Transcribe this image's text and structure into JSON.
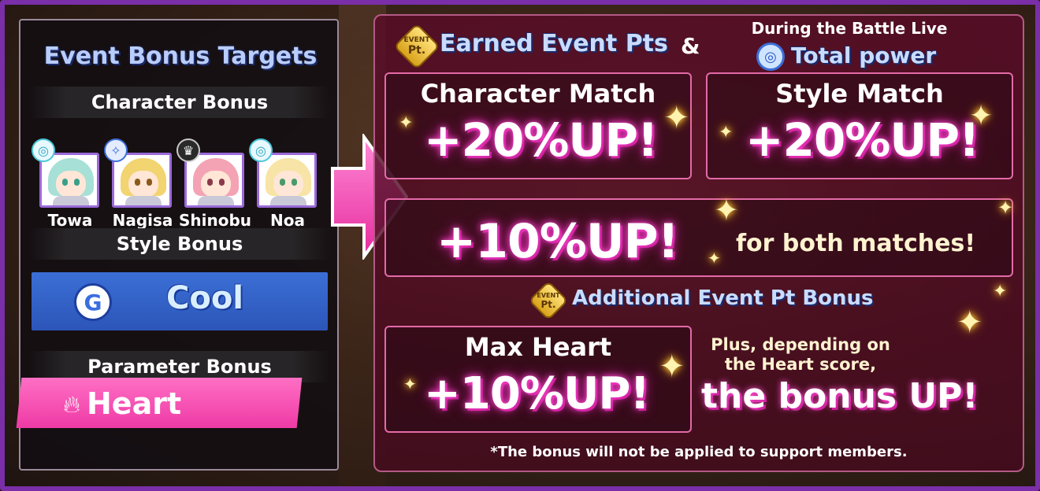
{
  "left": {
    "title": "Event Bonus Targets",
    "character_bonus_label": "Character Bonus",
    "characters": [
      {
        "name": "Towa",
        "hair": "#a7e0d6",
        "eye": "#3aa08a"
      },
      {
        "name": "Nagisa",
        "hair": "#f2d470",
        "eye": "#8a5a1a"
      },
      {
        "name": "Shinobu",
        "hair": "#f3a3b4",
        "eye": "#8a3a4a"
      },
      {
        "name": "Noa",
        "hair": "#f7e4a6",
        "eye": "#4a9a6a"
      }
    ],
    "style_bonus_label": "Style Bonus",
    "style": "Cool",
    "parameter_bonus_label": "Parameter Bonus",
    "parameter": "Heart"
  },
  "right": {
    "pt_icon_top": "EVENT",
    "pt_icon_bottom": "Pt.",
    "earned_title": "Earned Event Pts",
    "amp": "&",
    "during_label": "During the Battle Live",
    "total_power": "Total power",
    "character_match_label": "Character Match",
    "character_match_value": "+20%UP!",
    "style_match_label": "Style Match",
    "style_match_value": "+20%UP!",
    "both_value": "+10%UP!",
    "both_label": "for both matches!",
    "additional_title": "Additional Event Pt Bonus",
    "max_heart_label": "Max Heart",
    "max_heart_value": "+10%UP!",
    "plus_line1": "Plus, depending on",
    "plus_line2": "the Heart score,",
    "bonus_up": "the bonus UP!",
    "note": "*The bonus will not be applied to support members."
  },
  "colors": {
    "frame": "#7a2fa8",
    "accent_pink": "#ee3aa5",
    "cool_blue": "#2c55b8"
  }
}
